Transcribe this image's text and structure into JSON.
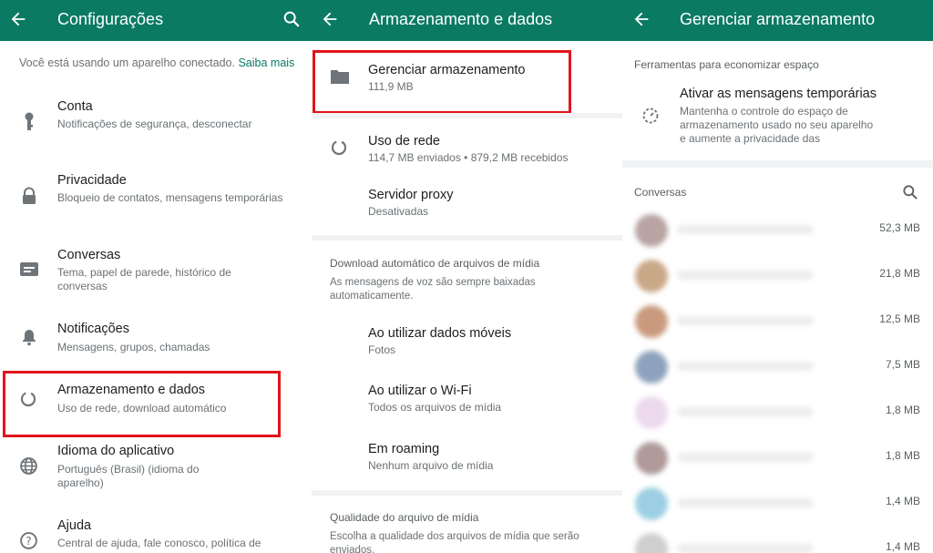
{
  "panel1": {
    "title": "Configurações",
    "info_text": "Você está usando um aparelho conectado.",
    "info_link": "Saiba mais",
    "items": [
      {
        "title": "Conta",
        "subtitle": "Notificações de segurança, desconectar"
      },
      {
        "title": "Privacidade",
        "subtitle": "Bloqueio de contatos, mensagens temporárias"
      },
      {
        "title": "Conversas",
        "subtitle": "Tema, papel de parede, histórico de conversas"
      },
      {
        "title": "Notificações",
        "subtitle": "Mensagens, grupos, chamadas"
      },
      {
        "title": "Armazenamento e dados",
        "subtitle": "Uso de rede, download automático"
      },
      {
        "title": "Idioma do aplicativo",
        "subtitle": "Português (Brasil) (idioma do aparelho)"
      },
      {
        "title": "Ajuda",
        "subtitle": "Central de ajuda, fale conosco, política de"
      }
    ]
  },
  "panel2": {
    "title": "Armazenamento e dados",
    "manage": {
      "title": "Gerenciar armazenamento",
      "subtitle": "111,9 MB"
    },
    "network": {
      "title": "Uso de rede",
      "subtitle": "114,7 MB enviados • 879,2 MB recebidos"
    },
    "proxy": {
      "title": "Servidor proxy",
      "subtitle": "Desativadas"
    },
    "auto_download": {
      "header": "Download automático de arquivos de mídia",
      "note": "As mensagens de voz são sempre baixadas automaticamente.",
      "options": [
        {
          "title": "Ao utilizar dados móveis",
          "subtitle": "Fotos"
        },
        {
          "title": "Ao utilizar o Wi-Fi",
          "subtitle": "Todos os arquivos de mídia"
        },
        {
          "title": "Em roaming",
          "subtitle": "Nenhum arquivo de mídia"
        }
      ]
    },
    "quality": {
      "header": "Qualidade do arquivo de mídia",
      "note": "Escolha a qualidade dos arquivos de mídia que serão enviados."
    }
  },
  "panel3": {
    "title": "Gerenciar armazenamento",
    "tools_header": "Ferramentas para economizar espaço",
    "temp_messages": {
      "title": "Ativar as mensagens temporárias",
      "subtitle": "Mantenha o controle do espaço de armazenamento usado no seu aparelho e aumente a privacidade das"
    },
    "chats_header": "Conversas",
    "chats": [
      {
        "size": "52,3 MB",
        "avatar_color": "#b9a3a3"
      },
      {
        "size": "21,8 MB",
        "avatar_color": "#c9a888"
      },
      {
        "size": "12,5 MB",
        "avatar_color": "#c99a7e"
      },
      {
        "size": "7,5 MB",
        "avatar_color": "#8fa2bd"
      },
      {
        "size": "1,8 MB",
        "avatar_color": "#ecd9ee"
      },
      {
        "size": "1,8 MB",
        "avatar_color": "#b09a9a"
      },
      {
        "size": "1,4 MB",
        "avatar_color": "#9ccfe3"
      },
      {
        "size": "1,4 MB",
        "avatar_color": "#cfcfcf"
      }
    ]
  },
  "colors": {
    "appbar": "#0a7a63",
    "highlight": "#e1141a"
  }
}
